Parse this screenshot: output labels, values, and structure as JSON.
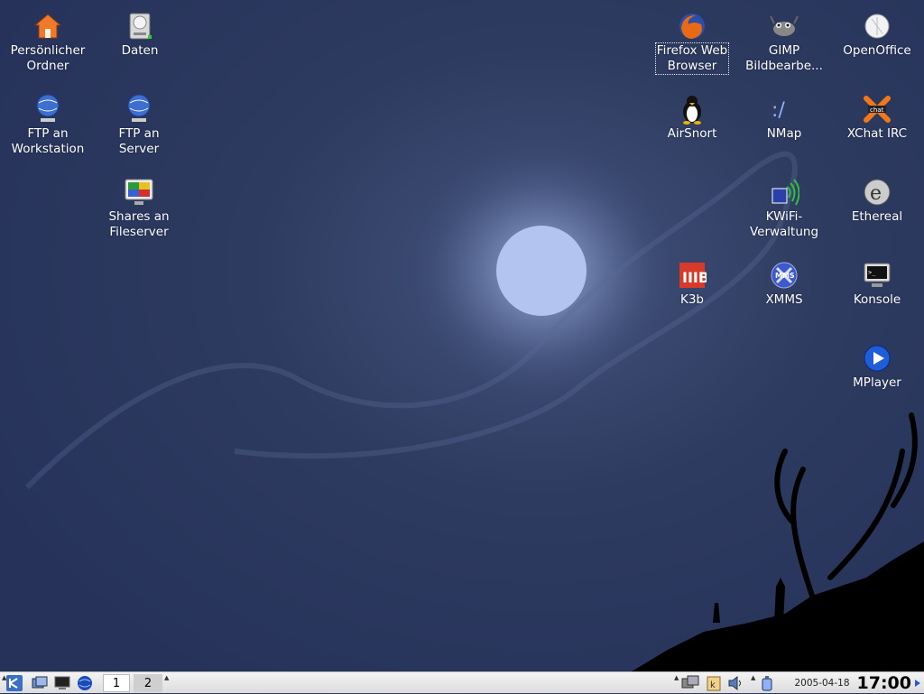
{
  "desktop": {
    "left_icons": [
      {
        "id": "home",
        "label": "Persönlicher\nOrdner",
        "icon": "home-folder-icon"
      },
      {
        "id": "daten",
        "label": "Daten",
        "icon": "hard-drive-icon"
      },
      {
        "id": "ftp-ws",
        "label": "FTP an\nWorkstation",
        "icon": "network-globe-icon"
      },
      {
        "id": "ftp-srv",
        "label": "FTP an\nServer",
        "icon": "network-globe-icon"
      },
      {
        "id": "shares",
        "label": "Shares an\nFileserver",
        "icon": "monitor-share-icon"
      }
    ],
    "right_icons": [
      {
        "id": "firefox",
        "label": "Firefox Web\nBrowser",
        "icon": "firefox-icon"
      },
      {
        "id": "gimp",
        "label": "GIMP\nBildbearbe...",
        "icon": "gimp-icon"
      },
      {
        "id": "openoffice",
        "label": "OpenOffice",
        "icon": "openoffice-icon"
      },
      {
        "id": "airsnort",
        "label": "AirSnort",
        "icon": "tux-icon"
      },
      {
        "id": "nmap",
        "label": "NMap",
        "icon": "nmap-icon"
      },
      {
        "id": "xchat",
        "label": "XChat IRC",
        "icon": "xchat-icon"
      },
      {
        "id": "kwifi",
        "label": "KWiFi-\nVerwaltung",
        "icon": "wifi-icon"
      },
      {
        "id": "ethereal",
        "label": "Ethereal",
        "icon": "ethereal-icon"
      },
      {
        "id": "k3b",
        "label": "K3b",
        "icon": "k3b-icon"
      },
      {
        "id": "xmms",
        "label": "XMMS",
        "icon": "xmms-icon"
      },
      {
        "id": "konsole",
        "label": "Konsole",
        "icon": "terminal-icon"
      },
      {
        "id": "mplayer",
        "label": "MPlayer",
        "icon": "mplayer-play-icon"
      }
    ]
  },
  "taskbar": {
    "pager": [
      "1",
      "2"
    ],
    "date": "2005-04-18",
    "time": "17:00"
  },
  "colors": {
    "wallpaper": "#2e3b60",
    "moon": "#b4c4f0",
    "taskbar": "#e8e8e8"
  }
}
